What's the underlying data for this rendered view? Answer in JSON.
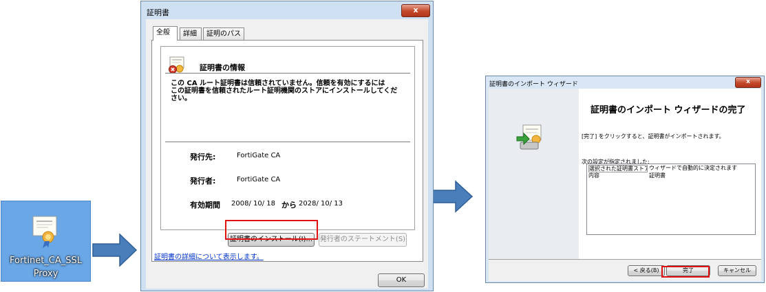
{
  "desktop_icon": {
    "line1": "Fortinet_CA_SSL",
    "line2": "Proxy"
  },
  "certificate_dialog": {
    "title": "証明書",
    "close": "x",
    "tabs": [
      "全般",
      "詳細",
      "証明のパス"
    ],
    "info_title": "証明書の情報",
    "message_lines": [
      "この CA ルート証明書は信頼されていません。信頼を有効にするには",
      "この証明書を信頼されたルート証明機関のストアにインストールしてくだ",
      "さい。"
    ],
    "issued_to_label": "発行先:",
    "issued_to_value": "FortiGate CA",
    "issued_by_label": "発行者:",
    "issued_by_value": "FortiGate CA",
    "validity_label": "有効期間",
    "valid_from": "2008/ 10/ 18",
    "validity_sep": "から",
    "valid_to": "2028/ 10/ 13",
    "install_button": "証明書のインストール(I)...",
    "issuer_statement_button": "発行者のステートメント(S)",
    "details_link": "証明書の詳細について表示します。",
    "ok_button": "OK"
  },
  "import_wizard": {
    "title": "証明書のインポート ウィザード",
    "close": "x",
    "heading": "証明書のインポート ウィザードの完了",
    "description": "[完了] をクリックすると、証明書がインポートされます。",
    "settings_label": "次の設定が指定されました:",
    "settings_rows": [
      {
        "key": "選択された証明書ストア",
        "value": "ウィザードで自動的に決定されます"
      },
      {
        "key": "内容",
        "value": "証明書"
      }
    ],
    "back_button": "< 戻る(B)",
    "finish_button": "完了",
    "cancel_button": "キャンセル"
  },
  "colors": {
    "highlight_box": "#e01010",
    "arrow": "#4a7ebb",
    "desktop_selection": "#6aa7e6"
  }
}
